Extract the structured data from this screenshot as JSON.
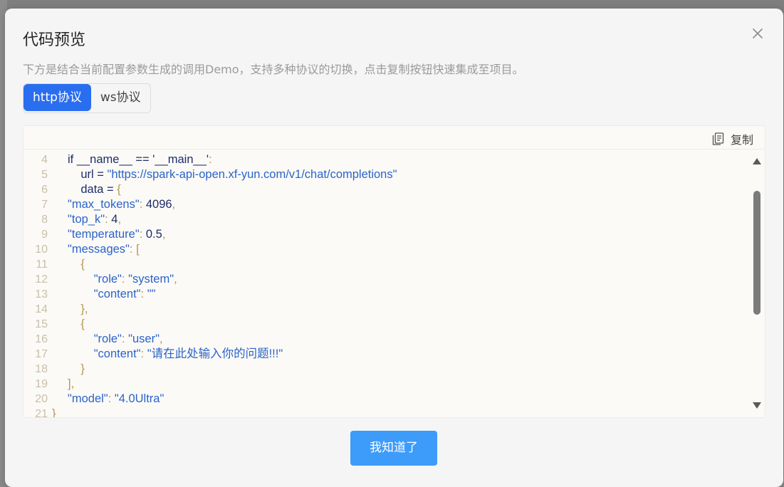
{
  "dialog": {
    "title": "代码预览",
    "subtitle": "下方是结合当前配置参数生成的调用Demo，支持多种协议的切换，点击复制按钮快速集成至项目。",
    "tabs": [
      {
        "label": "http协议",
        "active": true
      },
      {
        "label": "ws协议",
        "active": false
      }
    ],
    "copy_label": "复制",
    "confirm_label": "我知道了"
  },
  "code": {
    "lines": [
      {
        "n": "4",
        "text": "if __name__ == '__main__':"
      },
      {
        "n": "5",
        "text": "    url = \"https://spark-api-open.xf-yun.com/v1/chat/completions\""
      },
      {
        "n": "6",
        "text": "    data = {"
      },
      {
        "n": "7",
        "text": "\"max_tokens\": 4096,"
      },
      {
        "n": "8",
        "text": "\"top_k\": 4,"
      },
      {
        "n": "9",
        "text": "\"temperature\": 0.5,"
      },
      {
        "n": "10",
        "text": "\"messages\": ["
      },
      {
        "n": "11",
        "text": "    {"
      },
      {
        "n": "12",
        "text": "        \"role\": \"system\","
      },
      {
        "n": "13",
        "text": "        \"content\": \"\""
      },
      {
        "n": "14",
        "text": "    },"
      },
      {
        "n": "15",
        "text": "    {"
      },
      {
        "n": "16",
        "text": "        \"role\": \"user\","
      },
      {
        "n": "17",
        "text": "        \"content\": \"请在此处输入你的问题!!!\""
      },
      {
        "n": "18",
        "text": "    }"
      },
      {
        "n": "19",
        "text": "],"
      },
      {
        "n": "20",
        "text": "\"model\": \"4.0Ultra\""
      },
      {
        "n": "21",
        "text": "}"
      }
    ]
  },
  "icons": {
    "close": "close-icon",
    "copy": "copy-icon",
    "scroll_up": "scroll-up-icon",
    "scroll_down": "scroll-down-icon"
  },
  "colors": {
    "primary": "#2a6ef0",
    "confirm_button": "#3d9bfa",
    "string": "#2b63c9",
    "punct": "#b5974e",
    "line_number": "#c9bfa8"
  }
}
